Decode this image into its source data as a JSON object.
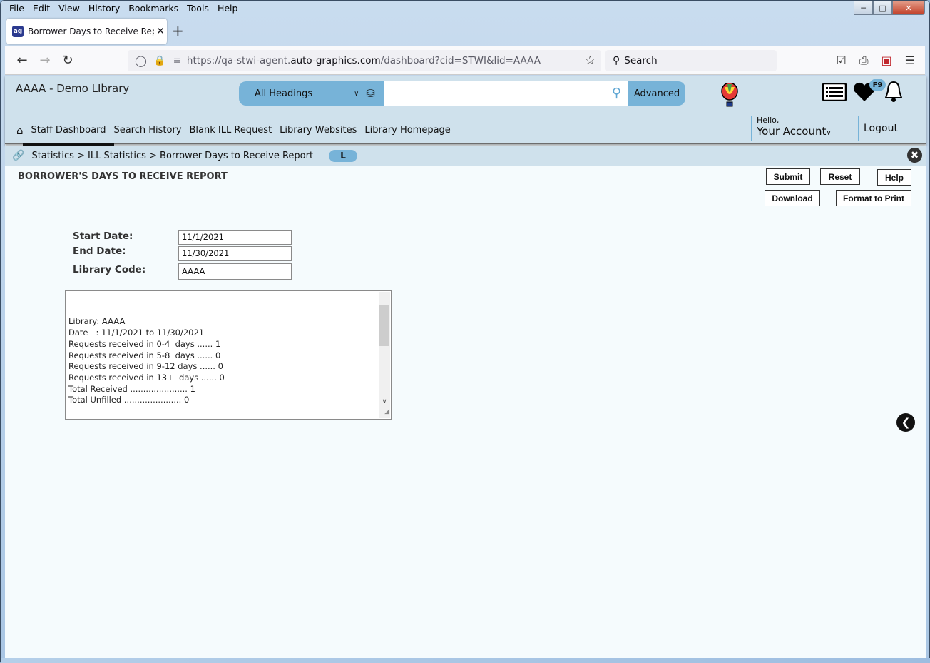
{
  "browser": {
    "menu": [
      "File",
      "Edit",
      "View",
      "History",
      "Bookmarks",
      "Tools",
      "Help"
    ],
    "tab": {
      "title": "Borrower Days to Receive Report",
      "favicon": "ag"
    },
    "new_tab_label": "+",
    "url_prefix": "https://qa-stwi-agent.",
    "url_domain": "auto-graphics.com",
    "url_path": "/dashboard?cid=STWI&lid=AAAA",
    "search_placeholder": "Search"
  },
  "header": {
    "library_name": "AAAA - Demo LIbrary",
    "search_scope": "All Headings",
    "search_value": "",
    "advanced_label": "Advanced",
    "fav_badge": "F9"
  },
  "nav": {
    "items": [
      "Staff Dashboard",
      "Search History",
      "Blank ILL Request",
      "Library Websites",
      "Library Homepage"
    ],
    "active": "Staff Dashboard",
    "hello": "Hello,",
    "account": "Your Account",
    "logout": "Logout"
  },
  "breadcrumb": {
    "text": "Statistics > ILL Statistics > Borrower Days to Receive Report",
    "badge": "L"
  },
  "report": {
    "title": "BORROWER'S DAYS TO RECEIVE REPORT",
    "buttons": {
      "submit": "Submit",
      "reset": "Reset",
      "help": "Help",
      "download": "Download",
      "print": "Format to Print"
    },
    "fields": {
      "start_label": "Start Date:",
      "start_value": "11/1/2021",
      "end_label": "End Date:",
      "end_value": "11/30/2021",
      "lib_label": "Library Code:",
      "lib_value": "AAAA"
    },
    "output": "Library: AAAA\nDate   : 11/1/2021 to 11/30/2021\nRequests received in 0-4  days ...... 1\nRequests received in 5-8  days ...... 0\nRequests received in 9-12 days ...... 0\nRequests received in 13+  days ...... 0\nTotal Received ...................... 1\nTotal Unfilled ...................... 0\n\n---------------------------"
  }
}
